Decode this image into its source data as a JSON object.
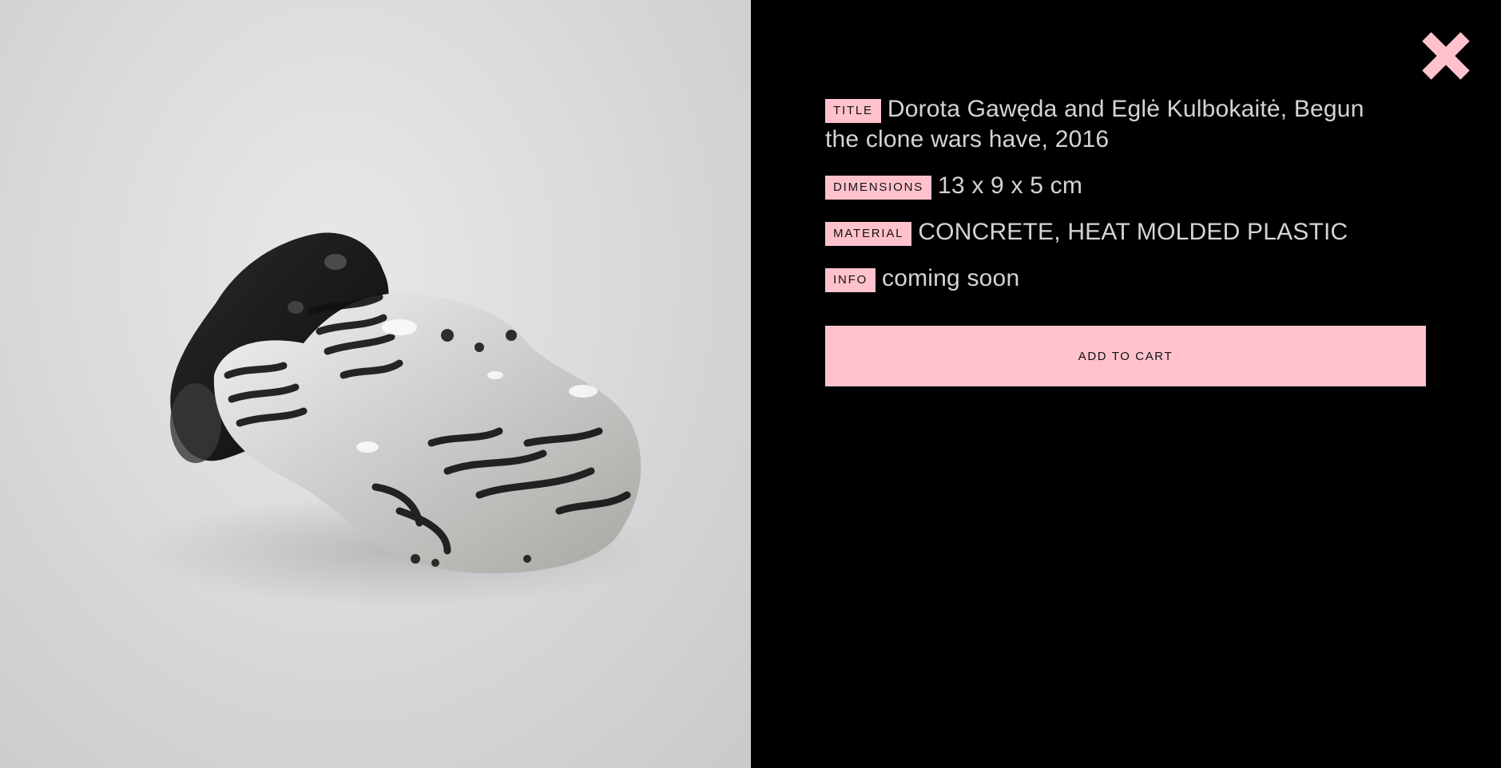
{
  "product": {
    "title_tag": "TITLE",
    "title": "Dorota Gawęda and Eglė Kulbokaitė, Begun the clone wars have, 2016",
    "dimensions_tag": "DIMENSIONS",
    "dimensions": "13 x 9 x 5 cm",
    "material_tag": "MATERIAL",
    "material": "CONCRETE, HEAT MOLDED PLASTIC",
    "info_tag": "INFO",
    "info": "coming soon"
  },
  "actions": {
    "add_to_cart_label": "ADD TO CART",
    "close_icon": "close-x-icon"
  },
  "colors": {
    "accent": "#ffc2cd",
    "panel_background": "#000000",
    "text": "#d4d4d4"
  }
}
